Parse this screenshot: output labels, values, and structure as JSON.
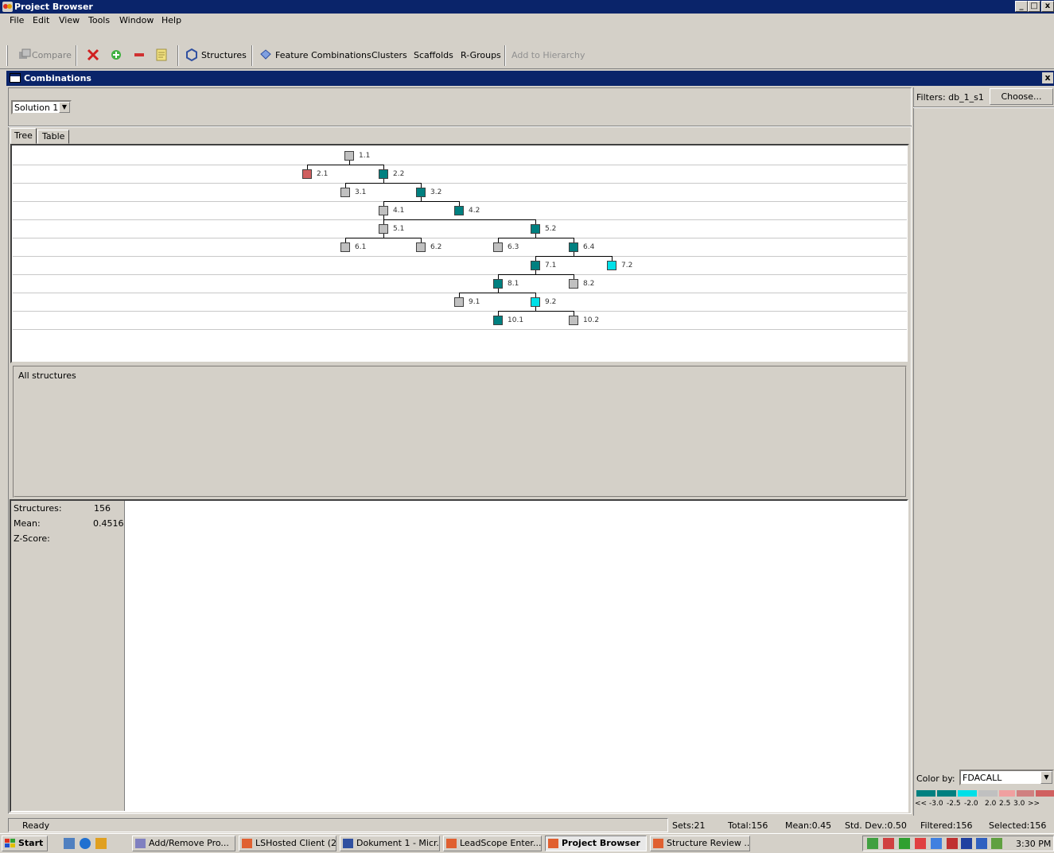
{
  "window": {
    "title": "Project Browser"
  },
  "menu": [
    "File",
    "Edit",
    "View",
    "Tools",
    "Window",
    "Help"
  ],
  "toolbar": {
    "compare": "Compare",
    "structures": "Structures",
    "feature_combinations": "Feature Combinations",
    "clusters": "Clusters",
    "scaffolds": "Scaffolds",
    "rgroups": "R-Groups",
    "add_to_hierarchy": "Add to Hierarchy"
  },
  "panel": {
    "title": "Combinations"
  },
  "solution": {
    "selected": "Solution 1"
  },
  "tabs": {
    "tree": "Tree",
    "table": "Table"
  },
  "colors": {
    "gray": "#c0c0c0",
    "teal": "#008080",
    "cyan": "#00e0e8",
    "red": "#d06060",
    "titlebar": "#0a246a"
  },
  "tree": {
    "nodes": [
      {
        "id": "1.1",
        "color": "gray"
      },
      {
        "id": "2.1",
        "color": "red"
      },
      {
        "id": "2.2",
        "color": "teal"
      },
      {
        "id": "3.1",
        "color": "gray"
      },
      {
        "id": "3.2",
        "color": "teal"
      },
      {
        "id": "4.1",
        "color": "gray"
      },
      {
        "id": "4.2",
        "color": "teal"
      },
      {
        "id": "5.1",
        "color": "gray"
      },
      {
        "id": "5.2",
        "color": "teal"
      },
      {
        "id": "6.1",
        "color": "gray"
      },
      {
        "id": "6.2",
        "color": "gray"
      },
      {
        "id": "6.3",
        "color": "gray"
      },
      {
        "id": "6.4",
        "color": "teal"
      },
      {
        "id": "7.1",
        "color": "teal"
      },
      {
        "id": "7.2",
        "color": "cyan"
      },
      {
        "id": "8.1",
        "color": "teal"
      },
      {
        "id": "8.2",
        "color": "gray"
      },
      {
        "id": "9.1",
        "color": "gray"
      },
      {
        "id": "9.2",
        "color": "cyan"
      },
      {
        "id": "10.1",
        "color": "teal"
      },
      {
        "id": "10.2",
        "color": "gray"
      }
    ]
  },
  "structures_panel": {
    "label": "All structures"
  },
  "stats": {
    "structures_label": "Structures:",
    "structures_value": "156",
    "mean_label": "Mean:",
    "mean_value": "0.4516",
    "zscore_label": "Z-Score:"
  },
  "filters": {
    "label": "Filters: db_1_s1",
    "choose": "Choose..."
  },
  "colorby": {
    "label": "Color by:",
    "value": "FDACALL",
    "legend": [
      "<<",
      "-3.0",
      "-2.5",
      "-2.0",
      "2.0",
      "2.5",
      "3.0",
      ">>"
    ]
  },
  "status": {
    "ready": "Ready",
    "sets": "Sets:21",
    "total": "Total:156",
    "mean": "Mean:0.45",
    "std": "Std. Dev.:0.50",
    "filtered": "Filtered:156",
    "selected": "Selected:156"
  },
  "taskbar": {
    "start": "Start",
    "tasks": [
      "Add/Remove Pro...",
      "LSHosted Client (2)",
      "Dokument 1 - Micr...",
      "LeadScope Enter...",
      "Project Browser",
      "Structure Review ..."
    ],
    "clock": "3:30 PM"
  }
}
